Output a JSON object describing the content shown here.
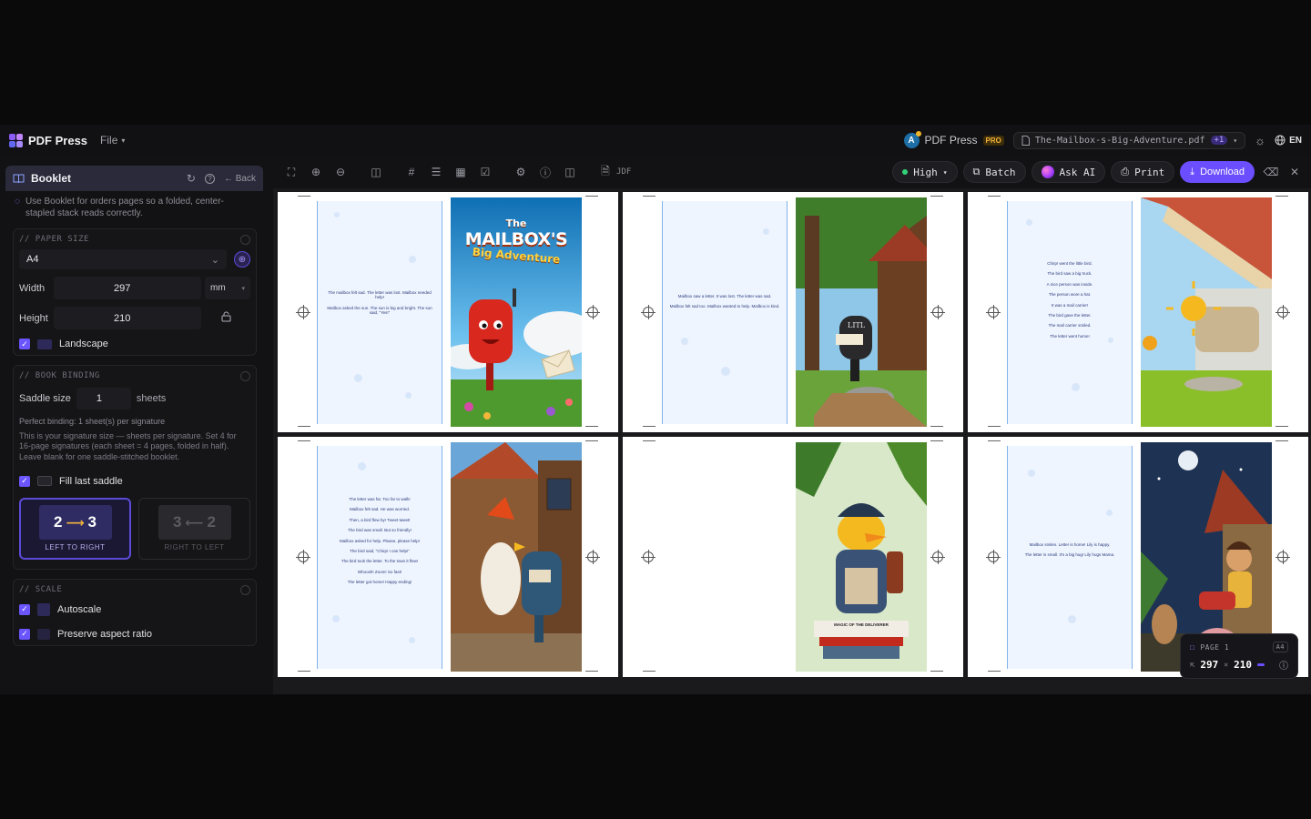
{
  "app": {
    "name": "PDF Press",
    "file_menu": "File"
  },
  "header": {
    "brand": "PDF Press",
    "avatar_letter": "A",
    "pro_badge": "PRO",
    "filename": "The-Mailbox-s-Big-Adventure.pdf",
    "file_extra_badge": "+1",
    "language": "EN"
  },
  "sidebar": {
    "panel_title": "Booklet",
    "back_label": "Back",
    "hint": "Use Booklet for orders pages so a folded, center-stapled stack reads correctly.",
    "paper_size": {
      "title": "// PAPER SIZE",
      "selected": "A4",
      "width_label": "Width",
      "width_value": "297",
      "unit": "mm",
      "height_label": "Height",
      "height_value": "210",
      "landscape_label": "Landscape",
      "landscape_checked": true
    },
    "book_binding": {
      "title": "// BOOK BINDING",
      "saddle_label": "Saddle size",
      "saddle_value": "1",
      "saddle_unit": "sheets",
      "perfect_binding": "Perfect binding: 1 sheet(s) per signature",
      "description": "This is your signature size — sheets per signature. Set 4 for 16-page signatures (each sheet = 4 pages, folded in half). Leave blank for one saddle-stitched booklet.",
      "fill_last_label": "Fill last saddle",
      "fill_last_checked": true,
      "directions": [
        {
          "label": "LEFT TO RIGHT",
          "from": "2",
          "to": "3",
          "active": true
        },
        {
          "label": "RIGHT TO LEFT",
          "from": "3",
          "to": "2",
          "active": false
        }
      ]
    },
    "scale": {
      "title": "// SCALE",
      "autoscale_label": "Autoscale",
      "autoscale_checked": true,
      "aspect_label": "Preserve aspect ratio",
      "aspect_checked": true
    }
  },
  "toolbar": {
    "jdf_label": "JDF",
    "quality": "High",
    "batch": "Batch",
    "ask_ai": "Ask AI",
    "print": "Print",
    "download": "Download"
  },
  "spreads": [
    {
      "lines": [
        "The mailbox felt sad. The letter was lost. Mailbox needed help!",
        "Mailbox asked the sun. The sun is big and bright. The sun said, \"Yes!\""
      ],
      "illustration": "cover",
      "cover_title": [
        "The",
        "MAILBOX'S",
        "Big Adventure"
      ]
    },
    {
      "lines": [
        "Mailbox saw a letter. It was lost. The letter was sad.",
        "Mailbox felt sad too. Mailbox wanted to help. Mailbox is kind."
      ],
      "illustration": "mailbox-tree",
      "mailbox_text": "LITL"
    },
    {
      "lines": [
        "Chirp! went the little bird.",
        "The bird saw a big truck.",
        "A nice person was inside.",
        "The person wore a hat.",
        "It was a mail carrier!",
        "The bird gave the letter.",
        "The mail carrier smiled.",
        "The letter went home!"
      ],
      "illustration": "sun-mailbox"
    },
    {
      "lines": [
        "The letter was far. Too far to walk!",
        "Mailbox felt sad. He was worried.",
        "Then, a bird flew by! Tweet tweet!",
        "The bird was small. But so friendly!",
        "Mailbox asked for help. Please, please help!",
        "The bird said, \"Chirp! I can help!\"",
        "The bird took the letter. To the town it flew!",
        "Whoosh! Zoom! So fast!",
        "The letter got home! Happy ending!"
      ],
      "illustration": "rooster"
    },
    {
      "lines": [],
      "illustration": "duck",
      "sign_text": "MAGIC OF THE DELIVERER"
    },
    {
      "lines": [
        "Mailbox smiles. Letter is home! Lily is happy.",
        "The letter is small. It's a big hug! Lily hugs Mama."
      ],
      "illustration": "night-girl"
    }
  ],
  "page_info": {
    "label": "PAGE 1",
    "size_tag": "A4",
    "width": "297",
    "height": "210"
  },
  "colors": {
    "accent": "#6b4eff",
    "panel_head": "#2a2a3a",
    "status_green": "#33d17a"
  }
}
